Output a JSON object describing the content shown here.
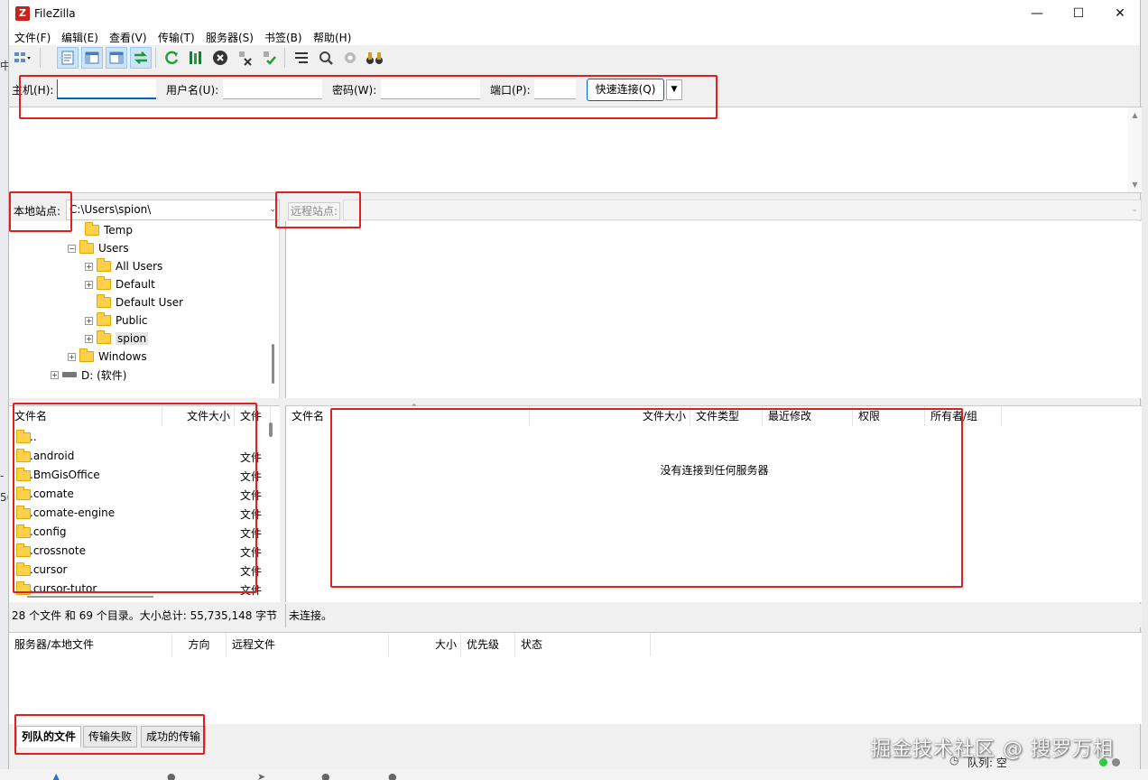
{
  "title": "FileZilla",
  "menu": [
    "文件(F)",
    "编辑(E)",
    "查看(V)",
    "传输(T)",
    "服务器(S)",
    "书签(B)",
    "帮助(H)"
  ],
  "quickconnect": {
    "host_label": "主机(H):",
    "host_value": "",
    "user_label": "用户名(U):",
    "user_value": "",
    "pass_label": "密码(W):",
    "pass_value": "",
    "port_label": "端口(P):",
    "port_value": "",
    "connect_label": "快速连接(Q)"
  },
  "local": {
    "site_label": "本地站点:",
    "path": "C:\\Users\\spion\\",
    "tree": [
      {
        "label": "Temp"
      },
      {
        "label": "Users"
      },
      {
        "label": "All Users"
      },
      {
        "label": "Default"
      },
      {
        "label": "Default User"
      },
      {
        "label": "Public"
      },
      {
        "label": "spion"
      },
      {
        "label": "Windows"
      },
      {
        "label": "D: (软件)"
      }
    ],
    "columns": [
      "文件名",
      "文件大小",
      "文件"
    ],
    "files": [
      {
        "name": "..",
        "type": ""
      },
      {
        "name": ".android",
        "type": "文件"
      },
      {
        "name": ".BmGisOffice",
        "type": "文件"
      },
      {
        "name": ".comate",
        "type": "文件"
      },
      {
        "name": ".comate-engine",
        "type": "文件"
      },
      {
        "name": ".config",
        "type": "文件"
      },
      {
        "name": ".crossnote",
        "type": "文件"
      },
      {
        "name": ".cursor",
        "type": "文件"
      },
      {
        "name": ".cursor-tutor",
        "type": "文件"
      }
    ],
    "status": "28 个文件 和 69 个目录。大小总计: 55,735,148 字节"
  },
  "remote": {
    "site_label": "远程站点:",
    "path": "",
    "columns": [
      "文件名",
      "文件大小",
      "文件类型",
      "最近修改",
      "权限",
      "所有者/组"
    ],
    "empty_message": "没有连接到任何服务器",
    "status": "未连接。"
  },
  "queue": {
    "columns": [
      "服务器/本地文件",
      "方向",
      "远程文件",
      "大小",
      "优先级",
      "状态"
    ],
    "tabs": [
      "列队的文件",
      "传输失败",
      "成功的传输"
    ],
    "status": "队列: 空"
  },
  "watermark": "掘金技术社区 @ 搜罗万相",
  "colors": {
    "annotation": "#e02020",
    "accent": "#0067c0",
    "led_green": "#2ecc40",
    "led_gray": "#888888"
  }
}
